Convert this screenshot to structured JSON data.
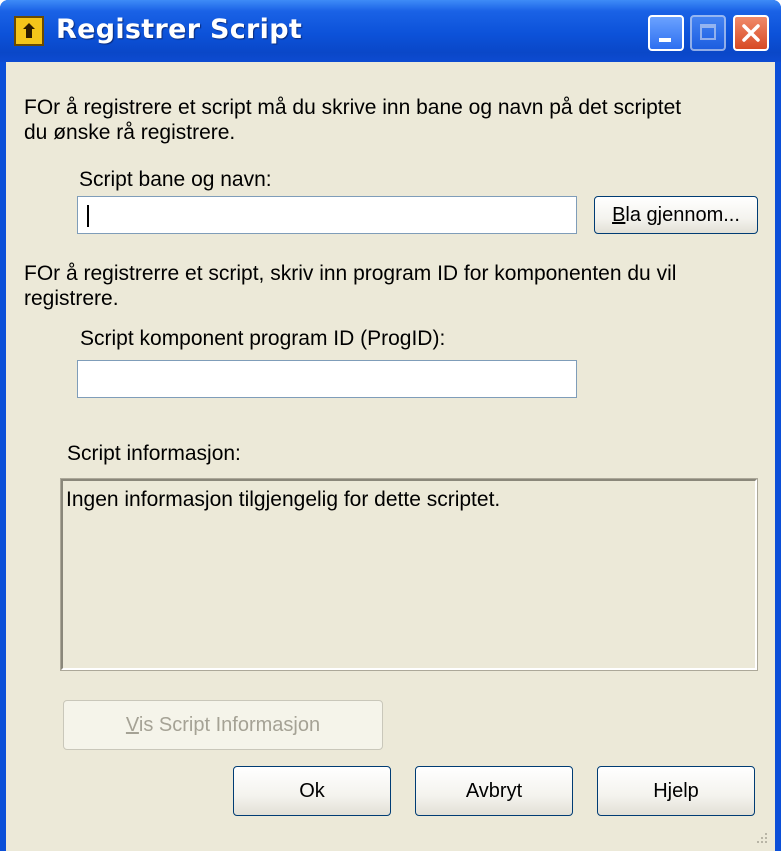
{
  "window": {
    "title": "Registrer Script",
    "minimize_icon": "minimize-icon",
    "maximize_icon": "maximize-icon",
    "close_icon": "close-icon"
  },
  "script_section": {
    "description_line1": "FOr å registrere et script må du skrive inn bane og navn på det scriptet",
    "description_line2": "du ønske rå registrere.",
    "path_label": "Script bane og navn:",
    "path_value": "",
    "browse_label_mnemonic": "B",
    "browse_label_rest": "la gjennom..."
  },
  "progid_section": {
    "description_line1": "FOr å registrerre et script, skriv inn program ID for komponenten du vil",
    "description_line2": "registrere.",
    "progid_label": "Script komponent program ID (ProgID):",
    "progid_value": ""
  },
  "info_section": {
    "label": "Script informasjon:",
    "text": "Ingen informasjon tilgjengelig for dette scriptet."
  },
  "buttons": {
    "show_info_mnemonic": "V",
    "show_info_rest": "is Script Informasjon",
    "ok": "Ok",
    "cancel": "Avbryt",
    "help": "Hjelp"
  },
  "colors": {
    "titlebar": "#0c52d9",
    "dialog_background": "#ece9d8",
    "close_button": "#d74a24"
  }
}
